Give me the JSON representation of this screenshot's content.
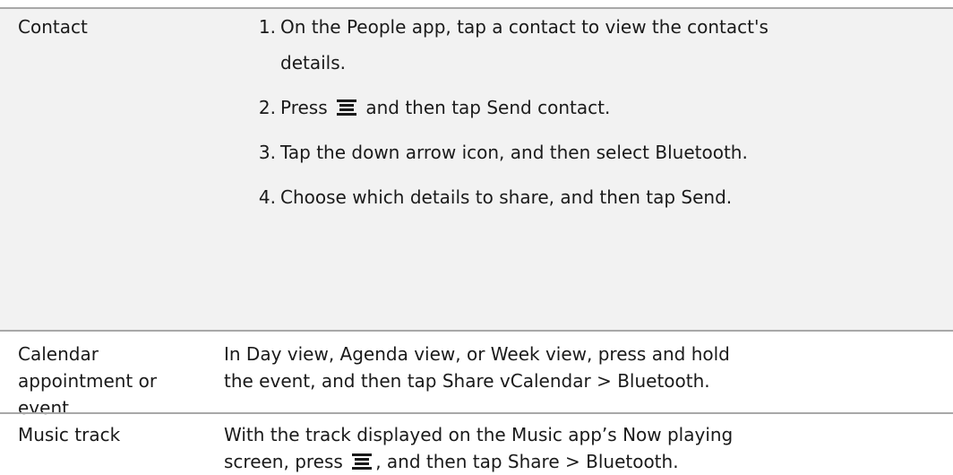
{
  "rows": [
    {
      "label": "Contact",
      "steps": [
        {
          "num": "1",
          "line1": "On the People app, tap a contact to view the contact's",
          "line2": "details."
        },
        {
          "num": "2",
          "before": "Press",
          "after": "and then tap",
          "target": "Send contact",
          "end": "."
        },
        {
          "num": "3",
          "before": "Tap the down arrow icon, and then select",
          "target": "Bluetooth",
          "end": "."
        },
        {
          "num": "4",
          "before": "Choose which details to share, and then tap",
          "target": "Send",
          "end": "."
        }
      ]
    },
    {
      "label_lines": [
        "Calendar",
        "appointment or",
        "event"
      ],
      "line1": "In Day view, Agenda view, or Week view, press and hold",
      "line2_before": "the event, and then tap",
      "target1": "Share vCalendar",
      "sep": ">",
      "target2": "Bluetooth",
      "end": "."
    },
    {
      "label": "Music track",
      "line1": "With the track displayed on the Music app’s Now playing",
      "line2_before": "screen, press",
      "line2_mid": ", and then tap",
      "target1": "Share",
      "sep": ">",
      "target2": "Bluetooth",
      "end": "."
    }
  ],
  "icons": {
    "menu": "menu-icon"
  },
  "colors": {
    "rule": "#a8a8a8",
    "shade": "#f2f2f2",
    "text": "#1a1a1a"
  }
}
